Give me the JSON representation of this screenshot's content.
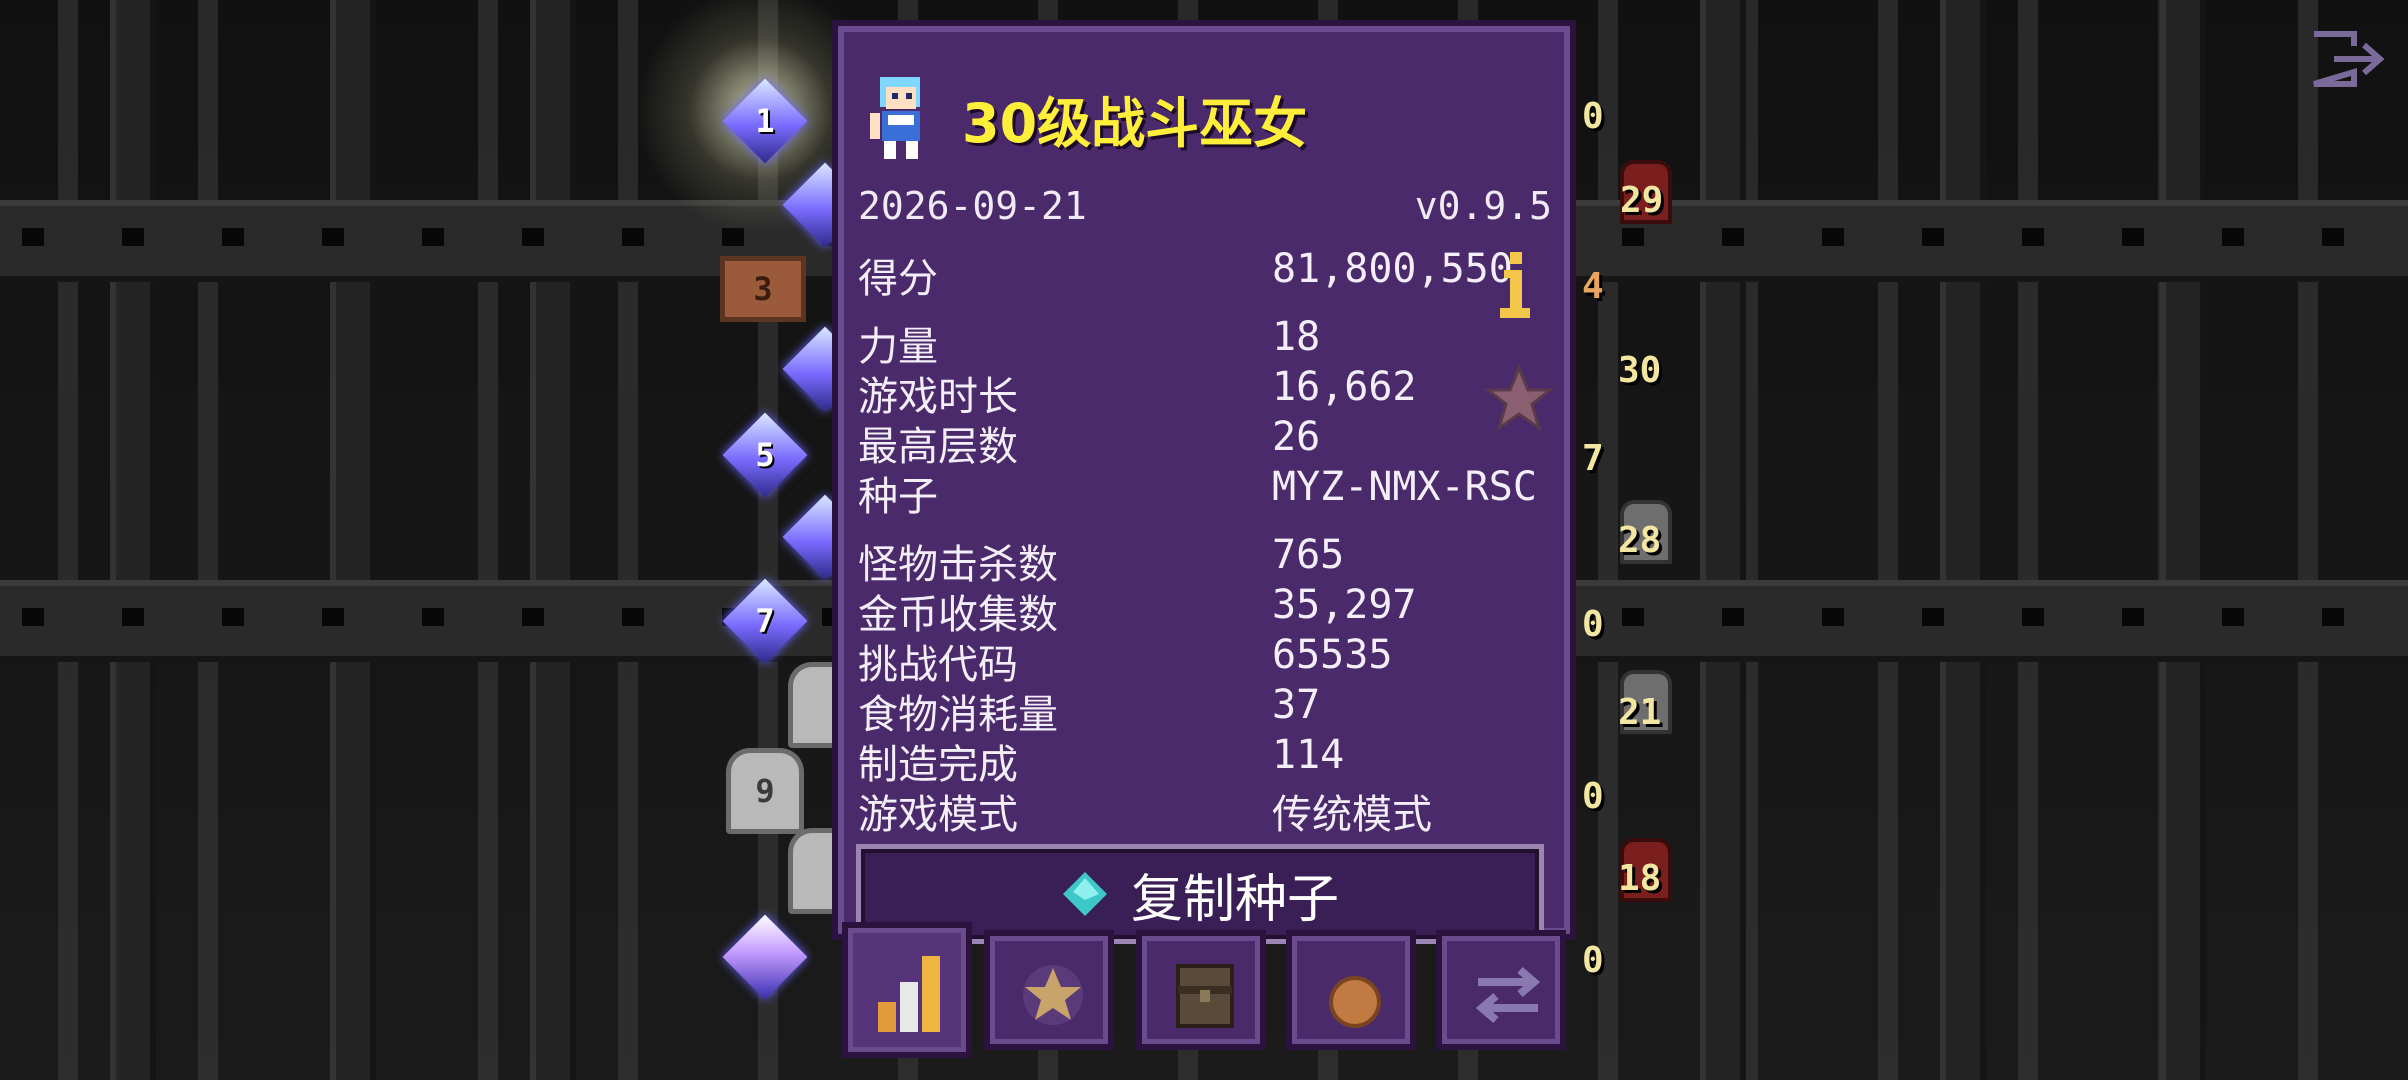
{
  "panel": {
    "title": "30级战斗巫女",
    "date": "2026-09-21",
    "version": "v0.9.5",
    "copy_button_label": "复制种子",
    "stats_group1": [
      {
        "label": "得分",
        "value": "81,800,550"
      }
    ],
    "stats_group2": [
      {
        "label": "力量",
        "value": "18"
      },
      {
        "label": "游戏时长",
        "value": "16,662"
      },
      {
        "label": "最高层数",
        "value": "26"
      },
      {
        "label": "种子",
        "value": "MYZ-NMX-RSC"
      }
    ],
    "stats_group3": [
      {
        "label": "怪物击杀数",
        "value": "765"
      },
      {
        "label": "金币收集数",
        "value": "35,297"
      },
      {
        "label": "挑战代码",
        "value": "65535"
      },
      {
        "label": "食物消耗量",
        "value": "37"
      },
      {
        "label": "制造完成",
        "value": "114"
      },
      {
        "label": "游戏模式",
        "value": "传统模式"
      }
    ]
  },
  "ranks_left": [
    "1",
    "3",
    "5",
    "7",
    "9"
  ],
  "ranks_right": [
    "0",
    "29",
    "4",
    "30",
    "7",
    "28",
    "0",
    "21",
    "0",
    "18",
    "0"
  ],
  "tabs": [
    {
      "icon": "stats-chart-icon",
      "active": true
    },
    {
      "icon": "star-badge-icon",
      "active": false
    },
    {
      "icon": "backpack-icon",
      "active": false
    },
    {
      "icon": "medal-icon",
      "active": false
    },
    {
      "icon": "swap-icon",
      "active": false
    }
  ],
  "colors": {
    "panel_bg": "#4a2a6a",
    "title_yellow": "#ffef3a",
    "text": "#f3eef8"
  }
}
